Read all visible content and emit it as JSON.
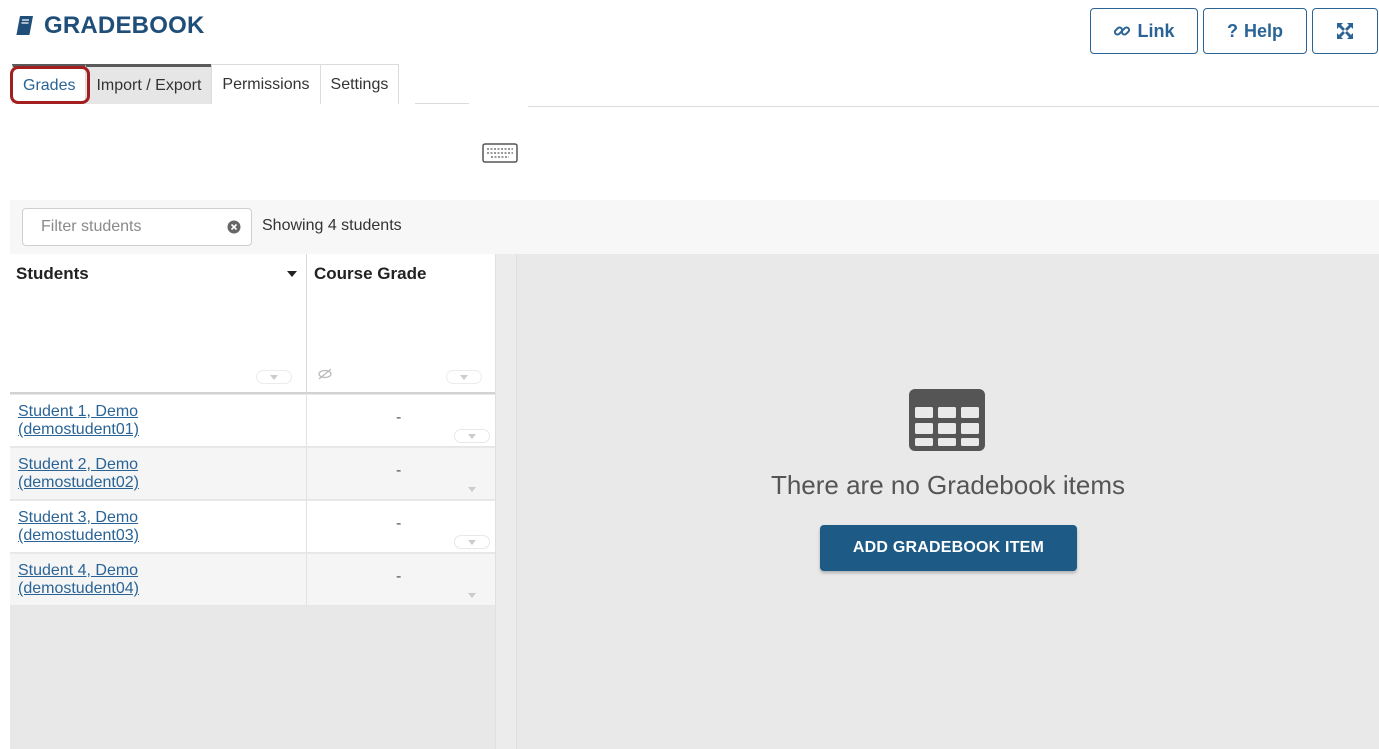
{
  "header": {
    "title": "GRADEBOOK",
    "link_label": "Link",
    "help_label": "Help",
    "help_prefix": "?"
  },
  "tabs": [
    {
      "label": "Grades",
      "active": true
    },
    {
      "label": "Import / Export"
    },
    {
      "label": "Permissions"
    },
    {
      "label": "Settings"
    }
  ],
  "toolbar": {
    "filter_placeholder": "Filter students",
    "showing_text": "Showing 4 students"
  },
  "grid": {
    "students_header": "Students",
    "course_grade_header": "Course Grade",
    "rows": [
      {
        "name": "Student 1, Demo",
        "id": "(demostudent01)",
        "grade": "-"
      },
      {
        "name": "Student 2, Demo",
        "id": "(demostudent02)",
        "grade": "-"
      },
      {
        "name": "Student 3, Demo",
        "id": "(demostudent03)",
        "grade": "-"
      },
      {
        "name": "Student 4, Demo",
        "id": "(demostudent04)",
        "grade": "-"
      }
    ]
  },
  "empty_state": {
    "message": "There are no Gradebook items",
    "button_label": "ADD GRADEBOOK ITEM"
  },
  "colors": {
    "title": "#1f4e79",
    "link": "#2a6496",
    "primary_button": "#1d5a85",
    "highlight": "#a31f1f"
  },
  "icons": {
    "title": "book-icon",
    "link": "link-icon",
    "fullscreen": "expand-icon",
    "keyboard": "keyboard-icon",
    "clear": "clear-circle-icon",
    "empty": "table-icon"
  }
}
